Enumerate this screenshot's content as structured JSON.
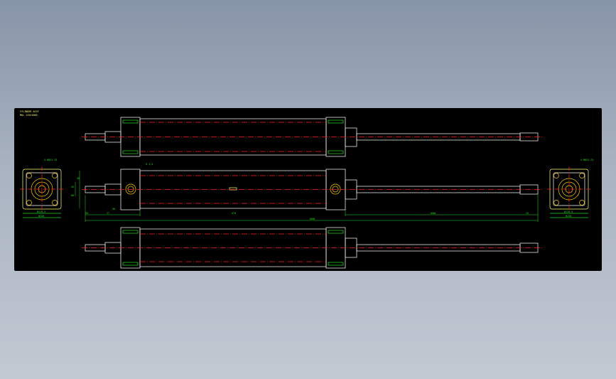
{
  "drawing": {
    "title_lines": [
      "CYLINDER ASSY",
      "MAL 125X1000"
    ],
    "colors": {
      "background": "#000000",
      "outline": "#ffffff",
      "body": "#ffff66",
      "centerline": "#ff2020",
      "dimension": "#22dd22",
      "port": "#ffcc00",
      "text": "#ffff66"
    }
  },
  "dimensions": {
    "left_end_callout": "4-M8X1.25",
    "right_end_callout": "4-M8X1.25",
    "port_callout": "G 1/4",
    "left_end_width_inner": "Φ125.5",
    "left_end_width_outer": "Φ150",
    "right_end_width_inner": "Φ125.5",
    "right_end_width_outer": "Φ150",
    "stroke_segment_a": "50",
    "stroke_segment_b": "27",
    "stroke_segment_c": "25",
    "body_length": "470",
    "rod_length": "1000",
    "overall_length": "1000",
    "rod_end": "50",
    "heights": [
      "30",
      "45",
      "60"
    ]
  }
}
